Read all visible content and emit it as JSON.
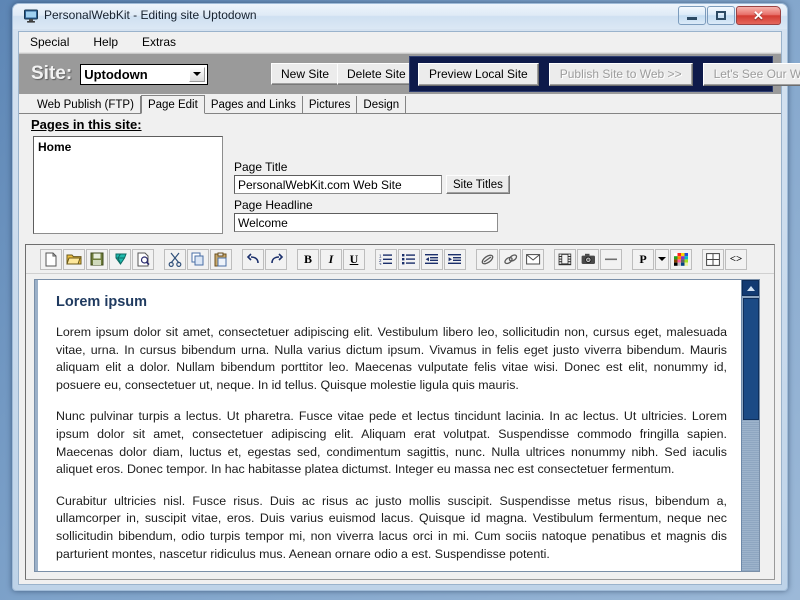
{
  "window": {
    "title": "PersonalWebKit - Editing site Uptodown",
    "icon": "app-monitor-icon",
    "controls": {
      "minimize": "Minimize",
      "maximize": "Maximize",
      "close": "Close"
    }
  },
  "menubar": {
    "items": [
      {
        "label": "Special"
      },
      {
        "label": "Help"
      },
      {
        "label": "Extras"
      }
    ]
  },
  "sitebar": {
    "site_label": "Site:",
    "site_selected": "Uptodown",
    "new_site": "New Site",
    "delete_site": "Delete Site",
    "publish_panel": {
      "preview": "Preview Local Site",
      "publish": "Publish Site to Web >>",
      "visit": "Let's See Our Web Site",
      "panel_color": "#0e1a4a"
    }
  },
  "tabs": [
    {
      "label": "Web Publish (FTP)",
      "active": false
    },
    {
      "label": "Page Edit",
      "active": true
    },
    {
      "label": "Pages and Links",
      "active": false
    },
    {
      "label": "Pictures",
      "active": false
    },
    {
      "label": "Design",
      "active": false
    }
  ],
  "pages_panel": {
    "heading": "Pages in this site:",
    "items": [
      {
        "label": "Home"
      }
    ]
  },
  "fields": {
    "page_title_label": "Page Title",
    "page_title_value": "PersonalWebKit.com Web Site",
    "site_titles_button": "Site Titles",
    "page_headline_label": "Page Headline",
    "page_headline_value": "Welcome"
  },
  "toolbar": {
    "buttons": [
      {
        "name": "new-document-icon",
        "title": "New"
      },
      {
        "name": "open-folder-icon",
        "title": "Open"
      },
      {
        "name": "save-disk-icon",
        "title": "Save"
      },
      {
        "name": "gem-icon",
        "title": "Insert Object"
      },
      {
        "name": "print-preview-icon",
        "title": "Print Preview"
      },
      {
        "name": "cut-scissors-icon",
        "title": "Cut"
      },
      {
        "name": "copy-icon",
        "title": "Copy"
      },
      {
        "name": "paste-clipboard-icon",
        "title": "Paste"
      },
      {
        "name": "undo-arrow-icon",
        "title": "Undo"
      },
      {
        "name": "redo-arrow-icon",
        "title": "Redo"
      },
      {
        "name": "bold-icon",
        "title": "Bold",
        "text": "B"
      },
      {
        "name": "italic-icon",
        "title": "Italic",
        "text": "I"
      },
      {
        "name": "underline-icon",
        "title": "Underline",
        "text": "U"
      },
      {
        "name": "numbered-list-icon",
        "title": "Numbered List"
      },
      {
        "name": "bulleted-list-icon",
        "title": "Bulleted List"
      },
      {
        "name": "outdent-icon",
        "title": "Decrease Indent"
      },
      {
        "name": "indent-icon",
        "title": "Increase Indent"
      },
      {
        "name": "insert-link-icon",
        "title": "Insert Link"
      },
      {
        "name": "remove-link-icon",
        "title": "Remove Link"
      },
      {
        "name": "email-link-icon",
        "title": "Email Link"
      },
      {
        "name": "film-media-icon",
        "title": "Insert Media"
      },
      {
        "name": "camera-image-icon",
        "title": "Insert Image"
      },
      {
        "name": "horizontal-rule-icon",
        "title": "Horizontal Rule"
      },
      {
        "name": "paragraph-style-icon",
        "title": "Paragraph Style",
        "text": "P"
      },
      {
        "name": "paragraph-style-dropdown-icon",
        "title": "Paragraph Style Options"
      },
      {
        "name": "color-palette-icon",
        "title": "Text Color"
      },
      {
        "name": "insert-table-icon",
        "title": "Insert Table"
      },
      {
        "name": "html-source-icon",
        "title": "HTML Source",
        "text": "<>"
      }
    ]
  },
  "document": {
    "heading": "Lorem ipsum",
    "paragraphs": [
      "Lorem ipsum dolor sit amet, consectetuer adipiscing elit. Vestibulum libero leo, sollicitudin non, cursus eget, malesuada vitae, urna. In cursus bibendum urna. Nulla varius dictum ipsum. Vivamus in felis eget justo viverra bibendum. Mauris aliquam elit a dolor. Nullam bibendum porttitor leo. Maecenas vulputate felis vitae wisi. Donec est elit, nonummy id, posuere eu, consectetuer ut, neque. In id tellus. Quisque molestie ligula quis mauris.",
      "Nunc pulvinar turpis a lectus. Ut pharetra. Fusce vitae pede et lectus tincidunt lacinia. In ac lectus. Ut ultricies. Lorem ipsum dolor sit amet, consectetuer adipiscing elit. Aliquam erat volutpat. Suspendisse commodo fringilla sapien. Maecenas dolor diam, luctus et, egestas sed, condimentum sagittis, nunc. Nulla ultrices nonummy nibh. Sed iaculis aliquet eros. Donec tempor. In hac habitasse platea dictumst. Integer eu massa nec est consectetuer fermentum.",
      "Curabitur ultricies nisl. Fusce risus. Duis ac risus ac justo mollis suscipit. Suspendisse metus risus, bibendum a, ullamcorper in, suscipit vitae, eros. Duis varius euismod lacus. Quisque id magna. Vestibulum fermentum, neque nec sollicitudin bibendum, odio turpis tempor mi, non viverra lacus orci in mi. Cum sociis natoque penatibus et magnis dis parturient montes, nascetur ridiculus mus. Aenean ornare odio a est. Suspendisse potenti."
    ],
    "heading_color": "#1f3a5f"
  },
  "scrollbar": {
    "up_arrow": "scroll-up-icon",
    "position": "top"
  }
}
